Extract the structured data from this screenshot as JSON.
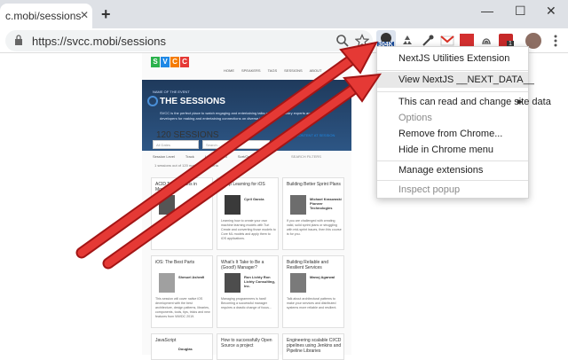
{
  "browser": {
    "tab_title": "c.mobi/sessions",
    "tab_close": "✕",
    "new_tab": "+",
    "window_controls": {
      "minimize": "—",
      "maximize": "☐",
      "close": "✕"
    },
    "url": "https://svcc.mobi/sessions",
    "extension_badge": "304K",
    "notification_badge": "1"
  },
  "site": {
    "logo_letters": [
      "S",
      "V",
      "C",
      "C"
    ],
    "logo_colors": [
      "#2bb24c",
      "#1e88e5",
      "#f57c00",
      "#e53935"
    ],
    "nav": [
      "HOME",
      "SPEAKERS",
      "TAGS",
      "SESSIONS",
      "ABOUT",
      "ACCO"
    ],
    "hero_eyebrow": "NAME OF THE EVENT",
    "hero_title": "THE SESSIONS",
    "hero_body": "SVCC is the perfect place to watch engaging and entertaining talks given by industry experts and meet with developers for making and entertaining connections on diverse topics",
    "sessions_heading": "120 SESSIONS",
    "sessions_link": "VIDEO CONTENT AT SESSION",
    "filter_all_dates": "All Dates",
    "filter_search": "Search...",
    "filter_row": [
      "Session Level",
      "Track",
      "Lecture Room",
      "Sort/Order"
    ],
    "showing": "1 sessions out of 120 match your criteria",
    "search_filters": "SEARCH FILTERS",
    "cards": [
      {
        "title": "ACID Transactions in MongoDB",
        "speaker": "",
        "text": ""
      },
      {
        "title": "Deep Learning for iOS",
        "speaker": "Cyril Garcia",
        "text": "Learning how to create your own machine learning models with Turi Create and converting those models to Core ML models and apply them to iOS applications."
      },
      {
        "title": "Building Better Sprint Plans",
        "speaker": "Michael Krasowski Pioneer Technologies",
        "text": "If you are challenged with creating valid, solid sprint plans or struggling with mid-sprint issues, then this course is for you."
      },
      {
        "title": "iOS: The Best Parts",
        "speaker": "Shmuel Ashrafi",
        "text": "This session will cover native iOS development with the best architecture, design patterns, libraries, components, tools, tips, tricks and new features from WWDC 2019."
      },
      {
        "title": "What's It Take to Be a (Good!) Manager?",
        "speaker": "Ron Lichty Ron Lichty Consulting, Inc.",
        "text": "Managing programmers is hard! Becoming a successful manager requires a drastic change of focus..."
      },
      {
        "title": "Building Reliable and Resilient Services",
        "speaker": "Manoj Agarwal",
        "text": "Talk about architectural patterns to make your services and distributed systems more reliable and resilient."
      },
      {
        "title": "JavaScript",
        "speaker": "Douglas",
        "text": ""
      },
      {
        "title": "How to successfully Open Source a project",
        "speaker": "",
        "text": ""
      },
      {
        "title": "Engineering scalable CI/CD pipelines using Jenkins and Pipeline Libraries",
        "speaker": "",
        "text": ""
      }
    ]
  },
  "context_menu": {
    "items": [
      {
        "label": "NextJS Utilities Extension",
        "disabled": false
      },
      {
        "label": "View NextJS __NEXT_DATA__",
        "disabled": false,
        "highlighted": true
      },
      {
        "label": "This can read and change site data",
        "disabled": false,
        "submenu": true
      },
      {
        "label": "Options",
        "disabled": true
      },
      {
        "label": "Remove from Chrome...",
        "disabled": false
      },
      {
        "label": "Hide in Chrome menu",
        "disabled": false
      },
      {
        "label": "Manage extensions",
        "disabled": false
      },
      {
        "label": "Inspect popup",
        "disabled": true
      }
    ],
    "submenu_arrow": "▶"
  },
  "colors": {
    "arrow_red": "#e53935",
    "highlight": "#e8e8e8",
    "hero": "#1f3a5c"
  }
}
